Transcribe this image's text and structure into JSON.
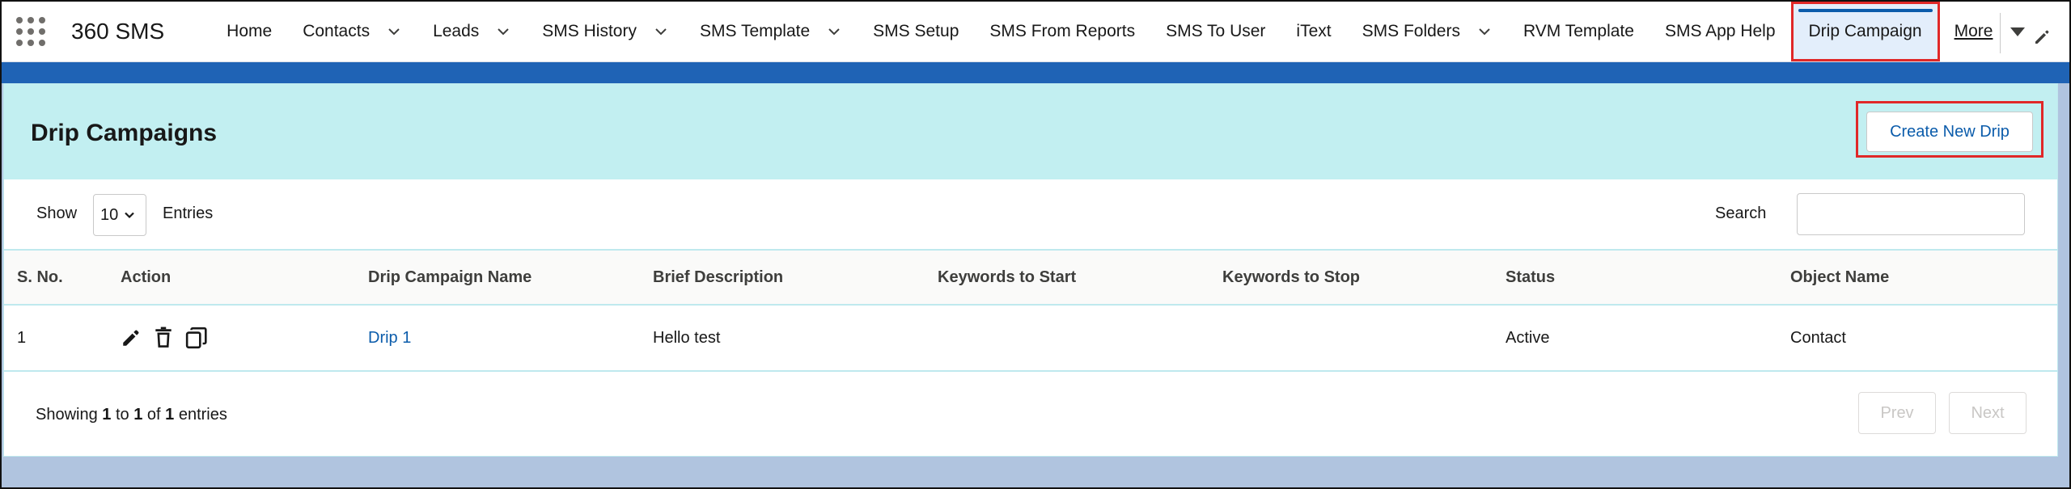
{
  "nav": {
    "app_name": "360 SMS",
    "items": [
      {
        "label": "Home",
        "dropdown": false
      },
      {
        "label": "Contacts",
        "dropdown": true
      },
      {
        "label": "Leads",
        "dropdown": true
      },
      {
        "label": "SMS History",
        "dropdown": true
      },
      {
        "label": "SMS Template",
        "dropdown": true
      },
      {
        "label": "SMS Setup",
        "dropdown": false
      },
      {
        "label": "SMS From Reports",
        "dropdown": false
      },
      {
        "label": "SMS To User",
        "dropdown": false
      },
      {
        "label": "iText",
        "dropdown": false
      },
      {
        "label": "SMS Folders",
        "dropdown": true
      },
      {
        "label": "RVM Template",
        "dropdown": false
      },
      {
        "label": "SMS App Help",
        "dropdown": false
      },
      {
        "label": "Drip Campaign",
        "dropdown": false,
        "active": true
      }
    ],
    "more_label": "More",
    "icons": {
      "launcher": "app-launcher-icon",
      "edit": "pencil-icon",
      "chevron": "chevron-down-icon"
    }
  },
  "page": {
    "title": "Drip Campaigns",
    "create_button": "Create New Drip"
  },
  "controls": {
    "show_label": "Show",
    "page_size": "10",
    "entries_label": "Entries",
    "search_label": "Search",
    "search_value": ""
  },
  "table": {
    "columns": [
      "S. No.",
      "Action",
      "Drip Campaign Name",
      "Brief Description",
      "Keywords to Start",
      "Keywords to Stop",
      "Status",
      "Object Name"
    ],
    "rows": [
      {
        "sno": "1",
        "name": "Drip 1",
        "description": "Hello test",
        "keywords_start": "",
        "keywords_stop": "",
        "status": "Active",
        "object": "Contact"
      }
    ],
    "action_icons": [
      "pencil-icon",
      "trash-icon",
      "copy-icon"
    ]
  },
  "footer": {
    "showing_prefix": "Showing",
    "from": "1",
    "to_word": "to",
    "to": "1",
    "of_word": "of",
    "total": "1",
    "suffix": "entries",
    "prev_label": "Prev",
    "next_label": "Next"
  },
  "colors": {
    "accent": "#0b5cab",
    "header_band": "#c2eff1",
    "brand_band": "#1f63b5",
    "highlight": "#e02828",
    "background": "#b0c4df"
  }
}
